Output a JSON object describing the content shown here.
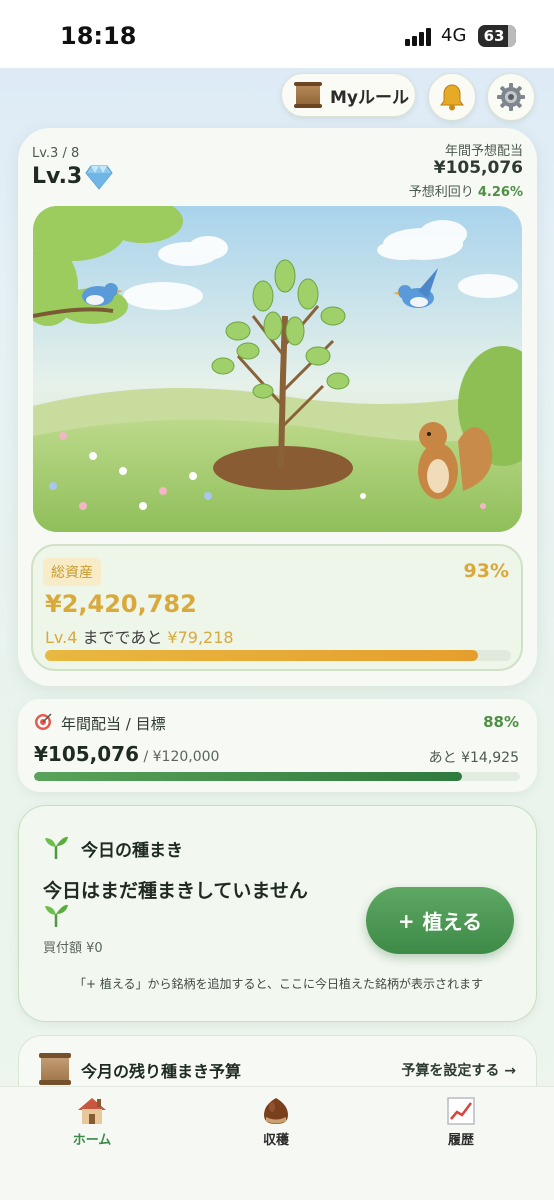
{
  "status_bar": {
    "time": "18:18",
    "network": "4G",
    "battery": "63"
  },
  "header": {
    "my_rule_label": "Myルール",
    "bell_icon": "bell-icon",
    "gear_icon": "gear-icon"
  },
  "level": {
    "small": "Lv.3 / 8",
    "big": "Lv.3",
    "annual_label": "年間予想配当",
    "annual_value": "¥105,076",
    "yield_label": "予想利回り",
    "yield_value": "4.26%"
  },
  "assets": {
    "badge": "総資産",
    "percent": "93%",
    "value": "¥2,420,782",
    "next_level": "Lv.4",
    "next_text": " までであと ",
    "next_amount": "¥79,218",
    "progress": 0.93
  },
  "target": {
    "label": "年間配当 / 目標",
    "percent": "88%",
    "value": "¥105,076",
    "goal": " / ¥120,000",
    "remain": "あと ¥14,925",
    "progress": 0.88
  },
  "sowing": {
    "title": "今日の種まき",
    "message": "今日はまだ種まきしていません",
    "amount": "買付額 ¥0",
    "button": "植える",
    "button_icon": "+",
    "hint": "「+ 植える」から銘柄を追加すると、ここに今日植えた銘柄が表示されます"
  },
  "budget": {
    "title": "今月の残り種まき予算",
    "link": "予算を設定する →"
  },
  "tabs": [
    {
      "label": "ホーム",
      "icon": "house-icon"
    },
    {
      "label": "収穫",
      "icon": "chestnut-icon"
    },
    {
      "label": "履歴",
      "icon": "chart-icon"
    }
  ],
  "colors": {
    "accent_green": "#3d8a47",
    "gold": "#d9a93c",
    "progress_orange": "#e59e2d"
  }
}
